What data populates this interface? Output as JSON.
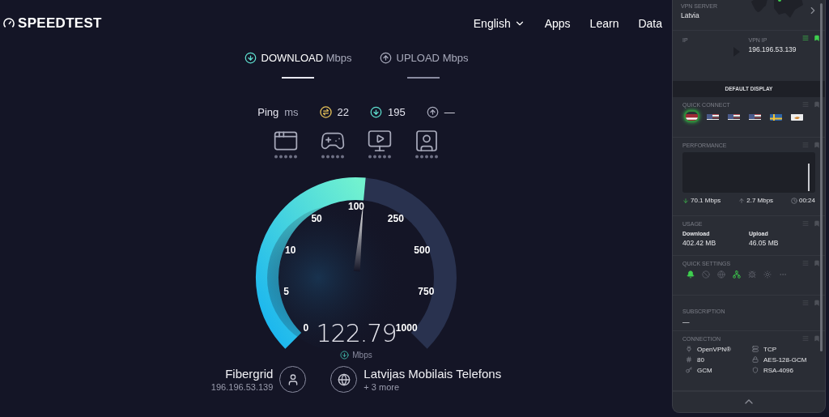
{
  "header": {
    "logo": "SPEEDTEST",
    "nav": [
      {
        "label": "English",
        "kind": "dropdown"
      },
      {
        "label": "Apps",
        "kind": "link"
      },
      {
        "label": "Learn",
        "kind": "link"
      },
      {
        "label": "Data",
        "kind": "link"
      }
    ]
  },
  "tabs": [
    {
      "label": "DOWNLOAD",
      "unit": "Mbps",
      "kind": "download",
      "selected": true
    },
    {
      "label": "UPLOAD",
      "unit": "Mbps",
      "kind": "upload",
      "selected": false
    }
  ],
  "ping": {
    "label": "Ping",
    "unit": "ms",
    "items": [
      {
        "kind": "idle",
        "value": "22"
      },
      {
        "kind": "download",
        "value": "195"
      },
      {
        "kind": "upload",
        "value": "—"
      }
    ]
  },
  "gauge": {
    "ticks": [
      "0",
      "5",
      "10",
      "50",
      "100",
      "250",
      "500",
      "750",
      "1000"
    ],
    "level": 0.52,
    "value": "122.79",
    "unit": "Mbps"
  },
  "provider": {
    "name": "Fibergrid",
    "ip": "196.196.53.139"
  },
  "server": {
    "name": "Latvijas Mobilais Telefons",
    "more": "+ 3 more"
  },
  "vpn": {
    "server_label": "VPN SERVER",
    "server": "Latvia",
    "ip_label": "IP",
    "vpn_ip_label": "VPN IP",
    "vpn_ip": "196.196.53.139",
    "display_button": "DEFAULT DISPLAY",
    "quick_connect": {
      "title": "QUICK CONNECT",
      "flags": [
        {
          "kind": "lv",
          "selected": true
        },
        {
          "kind": "us",
          "selected": false
        },
        {
          "kind": "us",
          "selected": false
        },
        {
          "kind": "us",
          "selected": false
        },
        {
          "kind": "se",
          "selected": false
        },
        {
          "kind": "cy",
          "selected": false
        }
      ]
    },
    "performance": {
      "title": "PERFORMANCE",
      "download": "70.1 Mbps",
      "upload": "2.7 Mbps",
      "time": "00:24"
    },
    "usage": {
      "title": "USAGE",
      "items": [
        {
          "label": "Download",
          "value": "402.42 MB"
        },
        {
          "label": "Upload",
          "value": "46.05 MB"
        }
      ]
    },
    "quick_settings": {
      "title": "QUICK SETTINGS",
      "items": [
        {
          "kind": "bell",
          "on": true
        },
        {
          "kind": "block",
          "on": false
        },
        {
          "kind": "globe",
          "on": false
        },
        {
          "kind": "network",
          "on": true
        },
        {
          "kind": "bug",
          "on": false
        },
        {
          "kind": "sun",
          "on": false
        },
        {
          "kind": "more",
          "on": false
        }
      ]
    },
    "subscription": {
      "title": "SUBSCRIPTION",
      "value": "—"
    },
    "connection": {
      "title": "CONNECTION",
      "items": [
        {
          "kind": "protocol",
          "value": "OpenVPN®"
        },
        {
          "kind": "transport",
          "value": "TCP"
        },
        {
          "kind": "port",
          "value": "80"
        },
        {
          "kind": "cipher",
          "value": "AES-128-GCM"
        },
        {
          "kind": "auth",
          "value": "GCM"
        },
        {
          "kind": "handshake",
          "value": "RSA-4096"
        }
      ]
    }
  }
}
